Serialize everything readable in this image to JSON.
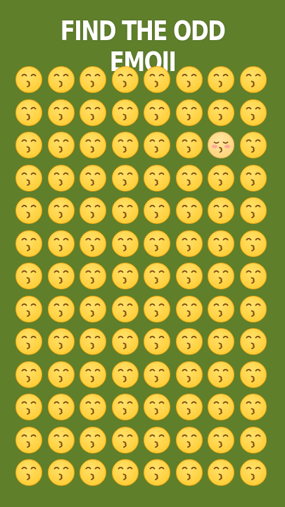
{
  "title": "FIND THE ODD EMOJI",
  "puzzle": {
    "rows": 13,
    "columns": 8,
    "common_emoji": "kissing-face-with-smiling-eyes",
    "odd_emoji": "kissing-face-with-closed-eyes-and-blush",
    "odd_position": {
      "row": 3,
      "column": 7
    }
  },
  "colors": {
    "background": "#5f7f2a",
    "face": "#ffcc33",
    "face_edge": "#f2a614",
    "feature": "#7a4a12",
    "blush": "#ff9a9a"
  }
}
